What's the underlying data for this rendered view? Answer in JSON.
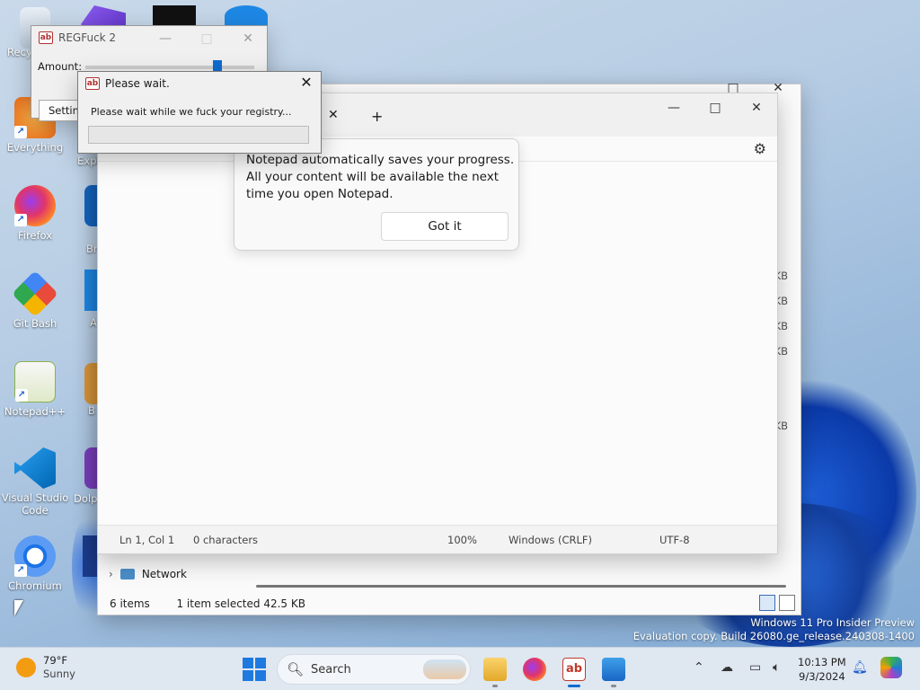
{
  "desktop": {
    "icons": [
      {
        "label": "Recy"
      },
      {
        "label": "Everything"
      },
      {
        "label": "Firefox"
      },
      {
        "label": "Git Bash"
      },
      {
        "label": "Notepad++"
      },
      {
        "label": "Visual Studio Code"
      },
      {
        "label": "Chromium"
      }
    ],
    "partial_labels": [
      "Expl",
      "Br",
      "B",
      "A",
      "B",
      "Dolp"
    ]
  },
  "explorer": {
    "sizes": [
      "KB",
      "KB",
      "KB",
      "KB",
      "KB"
    ],
    "nav_item": "Network",
    "status_items": "6 items",
    "status_selected": "1 item selected  42.5 KB"
  },
  "notepad": {
    "tip_message": "Notepad automatically saves your progress. All your content will be available the next time you open Notepad.",
    "tip_button": "Got it",
    "status": {
      "position": "Ln 1, Col 1",
      "chars": "0 characters",
      "zoom": "100%",
      "line_ending": "Windows (CRLF)",
      "encoding": "UTF-8"
    }
  },
  "regfuck": {
    "title": "REGFuck 2",
    "amount_label": "Amount:",
    "settings_label": "Settin",
    "icon_text": "ab"
  },
  "wait_dialog": {
    "title": "Please wait.",
    "message": "Please wait while we fuck your registry...",
    "progress": 0.0
  },
  "watermark": {
    "line1": "Windows 11 Pro Insider Preview",
    "line2": "Evaluation copy. Build 26080.ge_release.240308-1400"
  },
  "taskbar": {
    "weather_temp": "79°F",
    "weather_cond": "Sunny",
    "search_placeholder": "Search",
    "time": "10:13 PM",
    "date": "9/3/2024"
  },
  "colors": {
    "accent": "#0f6cd1",
    "progress": "#06b025"
  }
}
